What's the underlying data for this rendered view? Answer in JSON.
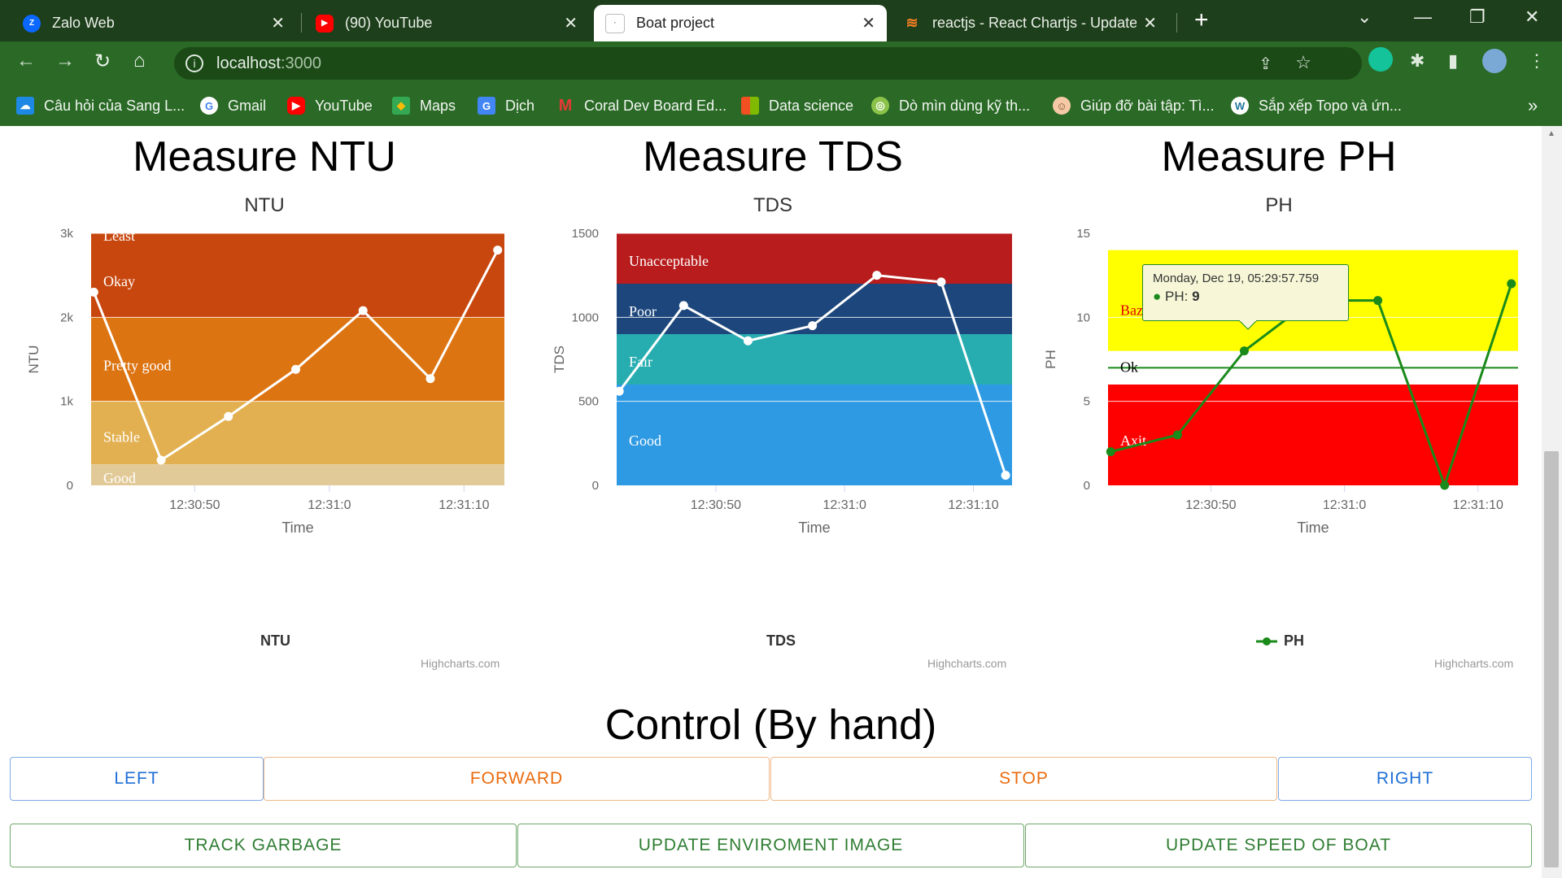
{
  "browser": {
    "tabs": [
      {
        "title": "Zalo Web",
        "icon": "zalo-icon"
      },
      {
        "title": "(90) YouTube",
        "icon": "youtube-icon"
      },
      {
        "title": "Boat project",
        "icon": "page-icon"
      },
      {
        "title": "reactjs - React Chartjs - Update C",
        "icon": "stackoverflow-icon"
      }
    ],
    "url_host": "localhost",
    "url_port": ":3000",
    "bookmarks": [
      {
        "label": "Câu hỏi của Sang L...",
        "icon": "onedrive-icon"
      },
      {
        "label": "Gmail",
        "icon": "google-icon"
      },
      {
        "label": "YouTube",
        "icon": "youtube-icon"
      },
      {
        "label": "Maps",
        "icon": "maps-icon"
      },
      {
        "label": "Dịch",
        "icon": "translate-icon"
      },
      {
        "label": "Coral Dev Board Ed...",
        "icon": "coral-icon"
      },
      {
        "label": "Data science",
        "icon": "microsoft-icon"
      },
      {
        "label": "Dò mìn dùng kỹ th...",
        "icon": "globe-icon"
      },
      {
        "label": "Giúp đỡ bài tập: Tì...",
        "icon": "avatar-icon"
      },
      {
        "label": "Sắp xếp Topo và ứn...",
        "icon": "wordpress-icon"
      }
    ],
    "bookmarks_more": "»"
  },
  "charts": [
    {
      "heading": "Measure NTU",
      "title": "NTU",
      "legend": "NTU",
      "credit": "Highcharts.com"
    },
    {
      "heading": "Measure TDS",
      "title": "TDS",
      "legend": "TDS",
      "credit": "Highcharts.com"
    },
    {
      "heading": "Measure PH",
      "title": "PH",
      "legend": "PH",
      "credit": "Highcharts.com"
    }
  ],
  "tooltip": {
    "date": "Monday, Dec 19, 05:29:57.759",
    "label": "PH:",
    "value": "9"
  },
  "control": {
    "title": "Control (By hand)",
    "row1": [
      "LEFT",
      "FORWARD",
      "STOP",
      "RIGHT"
    ],
    "row2": [
      "TRACK GARBAGE",
      "UPDATE ENVIROMENT IMAGE",
      "UPDATE SPEED OF BOAT"
    ]
  },
  "chart_data": [
    {
      "type": "line",
      "title": "NTU",
      "xlabel": "Time",
      "ylabel": "NTU",
      "x_ticks": [
        "12:30:50",
        "12:31:0",
        "12:31:10"
      ],
      "x_tick_positions_s": [
        50,
        60,
        70
      ],
      "x_range_s": [
        42.3,
        73.0
      ],
      "y_ticks": [
        "0",
        "1k",
        "2k",
        "3k"
      ],
      "ylim": [
        0,
        3000
      ],
      "series": [
        {
          "name": "NTU",
          "x_s": [
            42.5,
            47.5,
            52.5,
            57.5,
            62.5,
            67.5,
            72.5
          ],
          "values": [
            2300,
            300,
            820,
            1380,
            2080,
            1270,
            2800
          ],
          "color": "#ffffff"
        }
      ],
      "bands": [
        {
          "label": "Least",
          "from": 2000,
          "to": 3000,
          "color": "#c8470e"
        },
        {
          "label": "Okay",
          "from": 2000,
          "to": 3000,
          "color": "#c8470e"
        },
        {
          "label": "Pretty good",
          "from": 1000,
          "to": 2000,
          "color": "#dd7412"
        },
        {
          "label": "Stable",
          "from": 250,
          "to": 1000,
          "color": "#e2b050"
        },
        {
          "label": "Good",
          "from": 0,
          "to": 250,
          "color": "#e2ca98"
        }
      ],
      "legend": "NTU"
    },
    {
      "type": "line",
      "title": "TDS",
      "xlabel": "Time",
      "ylabel": "TDS",
      "x_ticks": [
        "12:30:50",
        "12:31:0",
        "12:31:10"
      ],
      "x_tick_positions_s": [
        50,
        60,
        70
      ],
      "x_range_s": [
        42.3,
        73.0
      ],
      "y_ticks": [
        "0",
        "500",
        "1000",
        "1500"
      ],
      "ylim": [
        0,
        1500
      ],
      "series": [
        {
          "name": "TDS",
          "x_s": [
            42.5,
            47.5,
            52.5,
            57.5,
            62.5,
            67.5,
            72.5
          ],
          "values": [
            560,
            1070,
            860,
            950,
            1250,
            1210,
            60
          ],
          "color": "#ffffff"
        }
      ],
      "bands": [
        {
          "label": "Unacceptable",
          "from": 1200,
          "to": 1500,
          "color": "#b81c1c"
        },
        {
          "label": "Poor",
          "from": 900,
          "to": 1200,
          "color": "#1d477c"
        },
        {
          "label": "Fair",
          "from": 600,
          "to": 900,
          "color": "#27adb0"
        },
        {
          "label": "Good",
          "from": 0,
          "to": 600,
          "color": "#2e9ae3"
        }
      ],
      "legend": "TDS"
    },
    {
      "type": "line",
      "title": "PH",
      "xlabel": "Time",
      "ylabel": "PH",
      "x_ticks": [
        "12:30:50",
        "12:31:0",
        "12:31:10"
      ],
      "x_tick_positions_s": [
        50,
        60,
        70
      ],
      "x_range_s": [
        42.3,
        73.0
      ],
      "y_ticks": [
        "0",
        "5",
        "10",
        "15"
      ],
      "ylim": [
        0,
        15
      ],
      "series": [
        {
          "name": "PH",
          "x_s": [
            42.5,
            47.5,
            52.5,
            57.5,
            62.5,
            67.5,
            72.5
          ],
          "values": [
            2,
            3,
            8,
            11,
            11,
            0,
            12
          ],
          "color": "#1a8a1a"
        }
      ],
      "bands": [
        {
          "label": "Bazo",
          "from": 8,
          "to": 14,
          "color": "#ffff00",
          "label_color": "#e00000"
        },
        {
          "label": "Ok",
          "from": 7,
          "to": 7,
          "color": "#1a8a1a",
          "line": true,
          "label_color": "#000000"
        },
        {
          "label": "Axit",
          "from": 0,
          "to": 6,
          "color": "#ff0000",
          "label_color": "#ffffff"
        }
      ],
      "legend": "PH"
    }
  ]
}
